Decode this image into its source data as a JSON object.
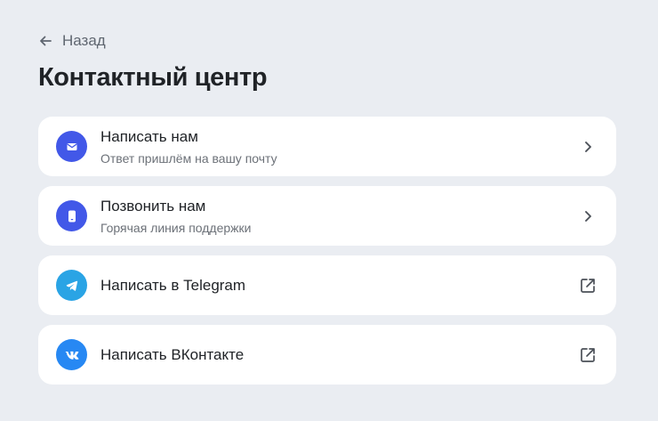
{
  "header": {
    "back_label": "Назад",
    "title": "Контактный центр"
  },
  "contacts": [
    {
      "title": "Написать нам",
      "subtitle": "Ответ пришлём на вашу почту",
      "icon": "mail-icon",
      "icon_color": "#4258e8",
      "action_icon": "chevron-right-icon"
    },
    {
      "title": "Позвонить нам",
      "subtitle": "Горячая линия поддержки",
      "icon": "phone-icon",
      "icon_color": "#4258e8",
      "action_icon": "chevron-right-icon"
    },
    {
      "title": "Написать в Telegram",
      "subtitle": "",
      "icon": "telegram-icon",
      "icon_color": "#2aa4e5",
      "action_icon": "external-link-icon"
    },
    {
      "title": "Написать ВКонтакте",
      "subtitle": "",
      "icon": "vk-icon",
      "icon_color": "#2788f3",
      "action_icon": "external-link-icon"
    }
  ]
}
